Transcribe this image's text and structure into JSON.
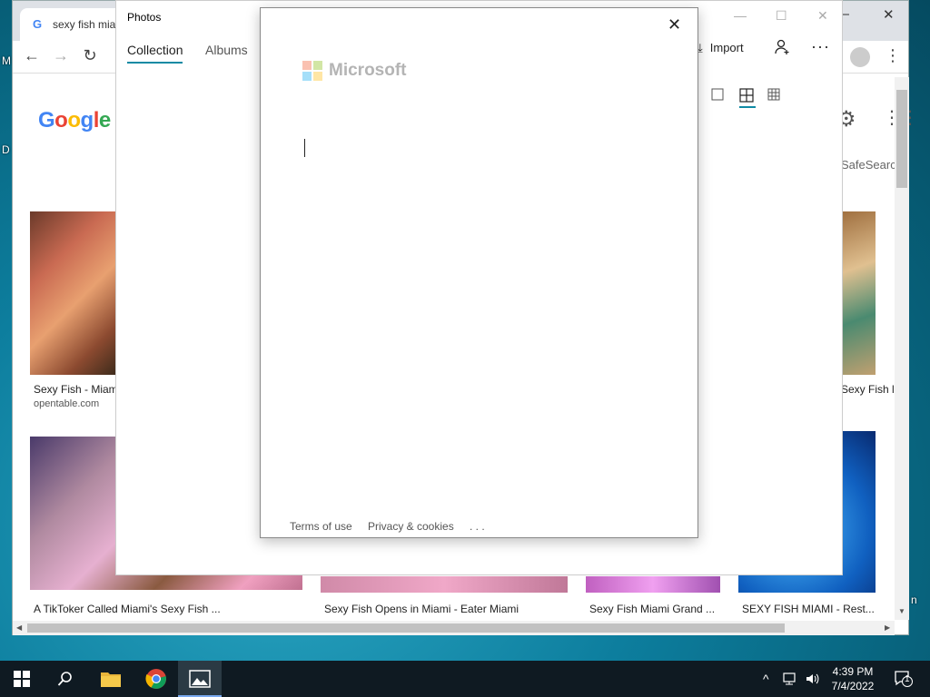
{
  "desktop": {
    "left_text_1": "M",
    "left_text_2": "D",
    "right_text": "n"
  },
  "browser": {
    "tab_title": "sexy fish miami",
    "favicon": "G",
    "nav": {
      "back": "←",
      "forward": "→",
      "reload": "↻"
    },
    "google_logo": "Google",
    "safesearch_label": "SafeSearch",
    "results": [
      {
        "caption": "Sexy Fish - Miami",
        "source": "opentable.com"
      },
      {
        "caption": "Sexy Fish l...",
        "source": ""
      },
      {
        "caption": "A TikToker Called Miami's Sexy Fish ...",
        "source": ""
      },
      {
        "caption": "Sexy Fish Opens in Miami - Eater Miami",
        "source": ""
      },
      {
        "caption": "Sexy Fish Miami Grand ...",
        "source": ""
      },
      {
        "caption": "SEXY FISH MIAMI - Rest...",
        "source": ""
      }
    ]
  },
  "photos": {
    "title": "Photos",
    "tabs": [
      "Collection",
      "Albums"
    ],
    "import_label": "Import"
  },
  "dialog": {
    "brand": "Microsoft",
    "footer": {
      "terms": "Terms of use",
      "privacy": "Privacy & cookies",
      "more": ". . ."
    }
  },
  "taskbar": {
    "time": "4:39 PM",
    "date": "7/4/2022",
    "notification_count": "1"
  },
  "colors": {
    "accent": "#0f8aa4",
    "ms_red": "#f25022",
    "ms_green": "#7fba00",
    "ms_blue": "#00a4ef",
    "ms_yellow": "#ffb900"
  }
}
